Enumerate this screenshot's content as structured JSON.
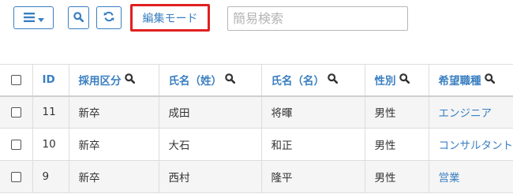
{
  "toolbar": {
    "edit_mode_label": "編集モード",
    "search_placeholder": "簡易検索",
    "search_value": ""
  },
  "table": {
    "headers": [
      "ID",
      "採用区分",
      "氏名（姓）",
      "氏名（名）",
      "性別",
      "希望職種"
    ],
    "rows": [
      {
        "id": "11",
        "category": "新卒",
        "last_name": "成田",
        "first_name": "将暉",
        "gender": "男性",
        "job": "エンジニア"
      },
      {
        "id": "10",
        "category": "新卒",
        "last_name": "大石",
        "first_name": "和正",
        "gender": "男性",
        "job": "コンサルタント"
      },
      {
        "id": "9",
        "category": "新卒",
        "last_name": "西村",
        "first_name": "隆平",
        "gender": "男性",
        "job": "営業"
      }
    ]
  },
  "colors": {
    "accent": "#3a7fc1",
    "highlight": "#e02020",
    "row_stripe": "#f5f5f5"
  },
  "icons": [
    "menu-icon",
    "caret-down-icon",
    "search-icon",
    "refresh-icon",
    "sort-search-icon"
  ]
}
